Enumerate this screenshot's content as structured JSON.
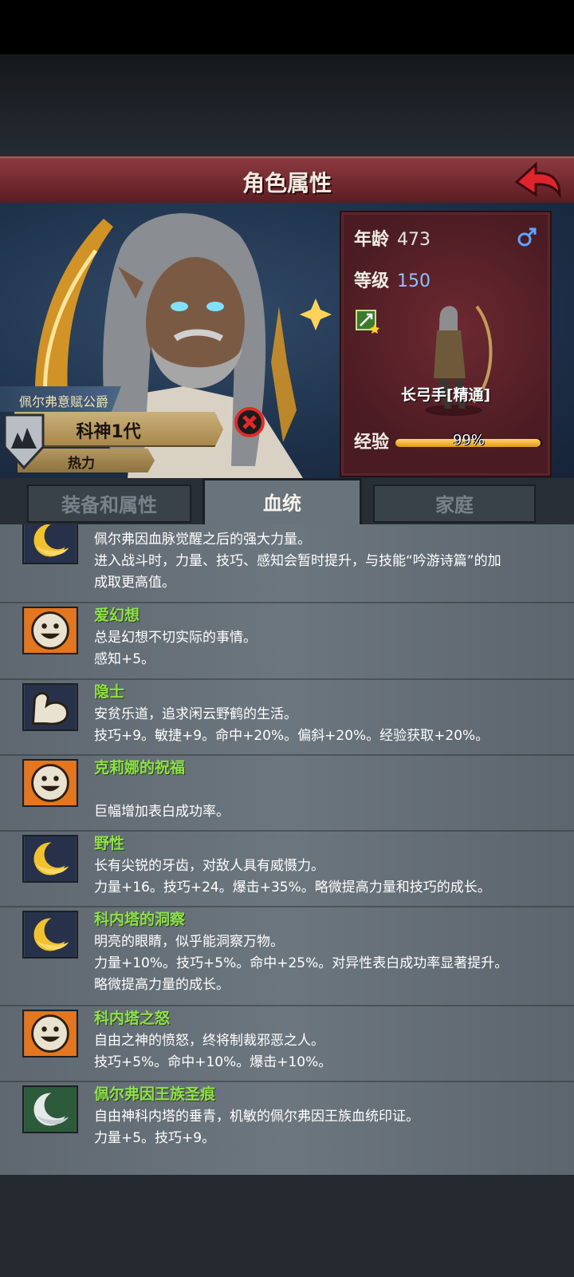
{
  "header": {
    "title": "角色属性"
  },
  "character": {
    "title": "佩尔弗意赋公爵",
    "name": "科神1代",
    "trait": "热力"
  },
  "stats": {
    "age_label": "年龄",
    "age": "473",
    "level_label": "等级",
    "level": "150",
    "class_name": "长弓手[精通]",
    "exp_label": "经验",
    "exp_text": "99%",
    "exp_fraction": 0.99
  },
  "tabs": [
    {
      "label": "装备和属性"
    },
    {
      "label": "血统"
    },
    {
      "label": "家庭"
    }
  ],
  "traits": [
    {
      "icon": "golden-moon-icon",
      "name": "",
      "lines": [
        "佩尔弗因血脉觉醒之后的强大力量。",
        "进入战斗时，力量、技巧、感知会暂时提升，与技能“吟游诗篇”的加",
        "成取更高值。"
      ]
    },
    {
      "icon": "smile-face-icon",
      "name": "爱幻想",
      "lines": [
        "总是幻想不切实际的事情。",
        "感知+5。"
      ]
    },
    {
      "icon": "flexed-arm-icon",
      "name": "隐士",
      "lines": [
        "安贫乐道，追求闲云野鹤的生活。",
        "技巧+9。敏捷+9。命中+20%。偏斜+20%。经验获取+20%。"
      ]
    },
    {
      "icon": "smile-face-icon",
      "name": "克莉娜的祝福",
      "lines": [
        "",
        "巨幅增加表白成功率。"
      ]
    },
    {
      "icon": "golden-moon-icon",
      "name": "野性",
      "lines": [
        "长有尖锐的牙齿，对敌人具有威慑力。",
        "力量+16。技巧+24。爆击+35%。略微提高力量和技巧的成长。"
      ]
    },
    {
      "icon": "golden-moon-icon",
      "name": "科内塔的洞察",
      "lines": [
        "明亮的眼睛，似乎能洞察万物。",
        "力量+10%。技巧+5%。命中+25%。对异性表白成功率显著提升。",
        "略微提高力量的成长。"
      ]
    },
    {
      "icon": "smile-face-icon",
      "name": "科内塔之怒",
      "lines": [
        "自由之神的愤怒，终将制裁邪恶之人。",
        "技巧+5%。命中+10%。爆击+10%。"
      ]
    },
    {
      "icon": "silver-moon-icon",
      "name": "佩尔弗因王族圣痕",
      "lines": [
        "自由神科内塔的垂青，机敏的佩尔弗因王族血统印证。",
        "力量+5。技巧+9。"
      ]
    }
  ]
}
